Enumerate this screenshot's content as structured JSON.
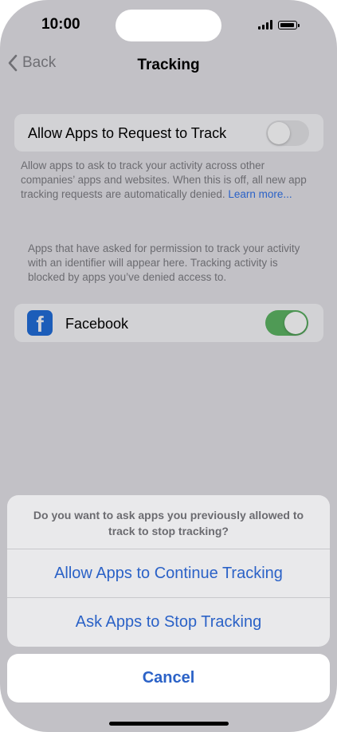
{
  "status_bar": {
    "time": "10:00"
  },
  "nav": {
    "back_label": "Back",
    "title": "Tracking"
  },
  "allow_request": {
    "label": "Allow Apps to Request to Track",
    "enabled": false
  },
  "allow_request_footnote": {
    "text": "Allow apps to ask to track your activity across other companies’ apps and websites. When this is off, all new app tracking requests are automatically denied. ",
    "link": "Learn more..."
  },
  "apps_info": "Apps that have asked for permission to track your activity with an identifier will appear here. Tracking activity is blocked by apps you’ve denied access to.",
  "apps": [
    {
      "name": "Facebook",
      "icon": "facebook-icon",
      "enabled": true
    }
  ],
  "action_sheet": {
    "message": "Do you want to ask apps you previously allowed to track to stop tracking?",
    "actions": [
      "Allow Apps to Continue Tracking",
      "Ask Apps to Stop Tracking"
    ],
    "cancel": "Cancel"
  },
  "colors": {
    "accent": "#2b62c7",
    "toggle_on": "#4f9a55",
    "toggle_off": "#c3c3c6",
    "facebook": "#1c5db9"
  }
}
